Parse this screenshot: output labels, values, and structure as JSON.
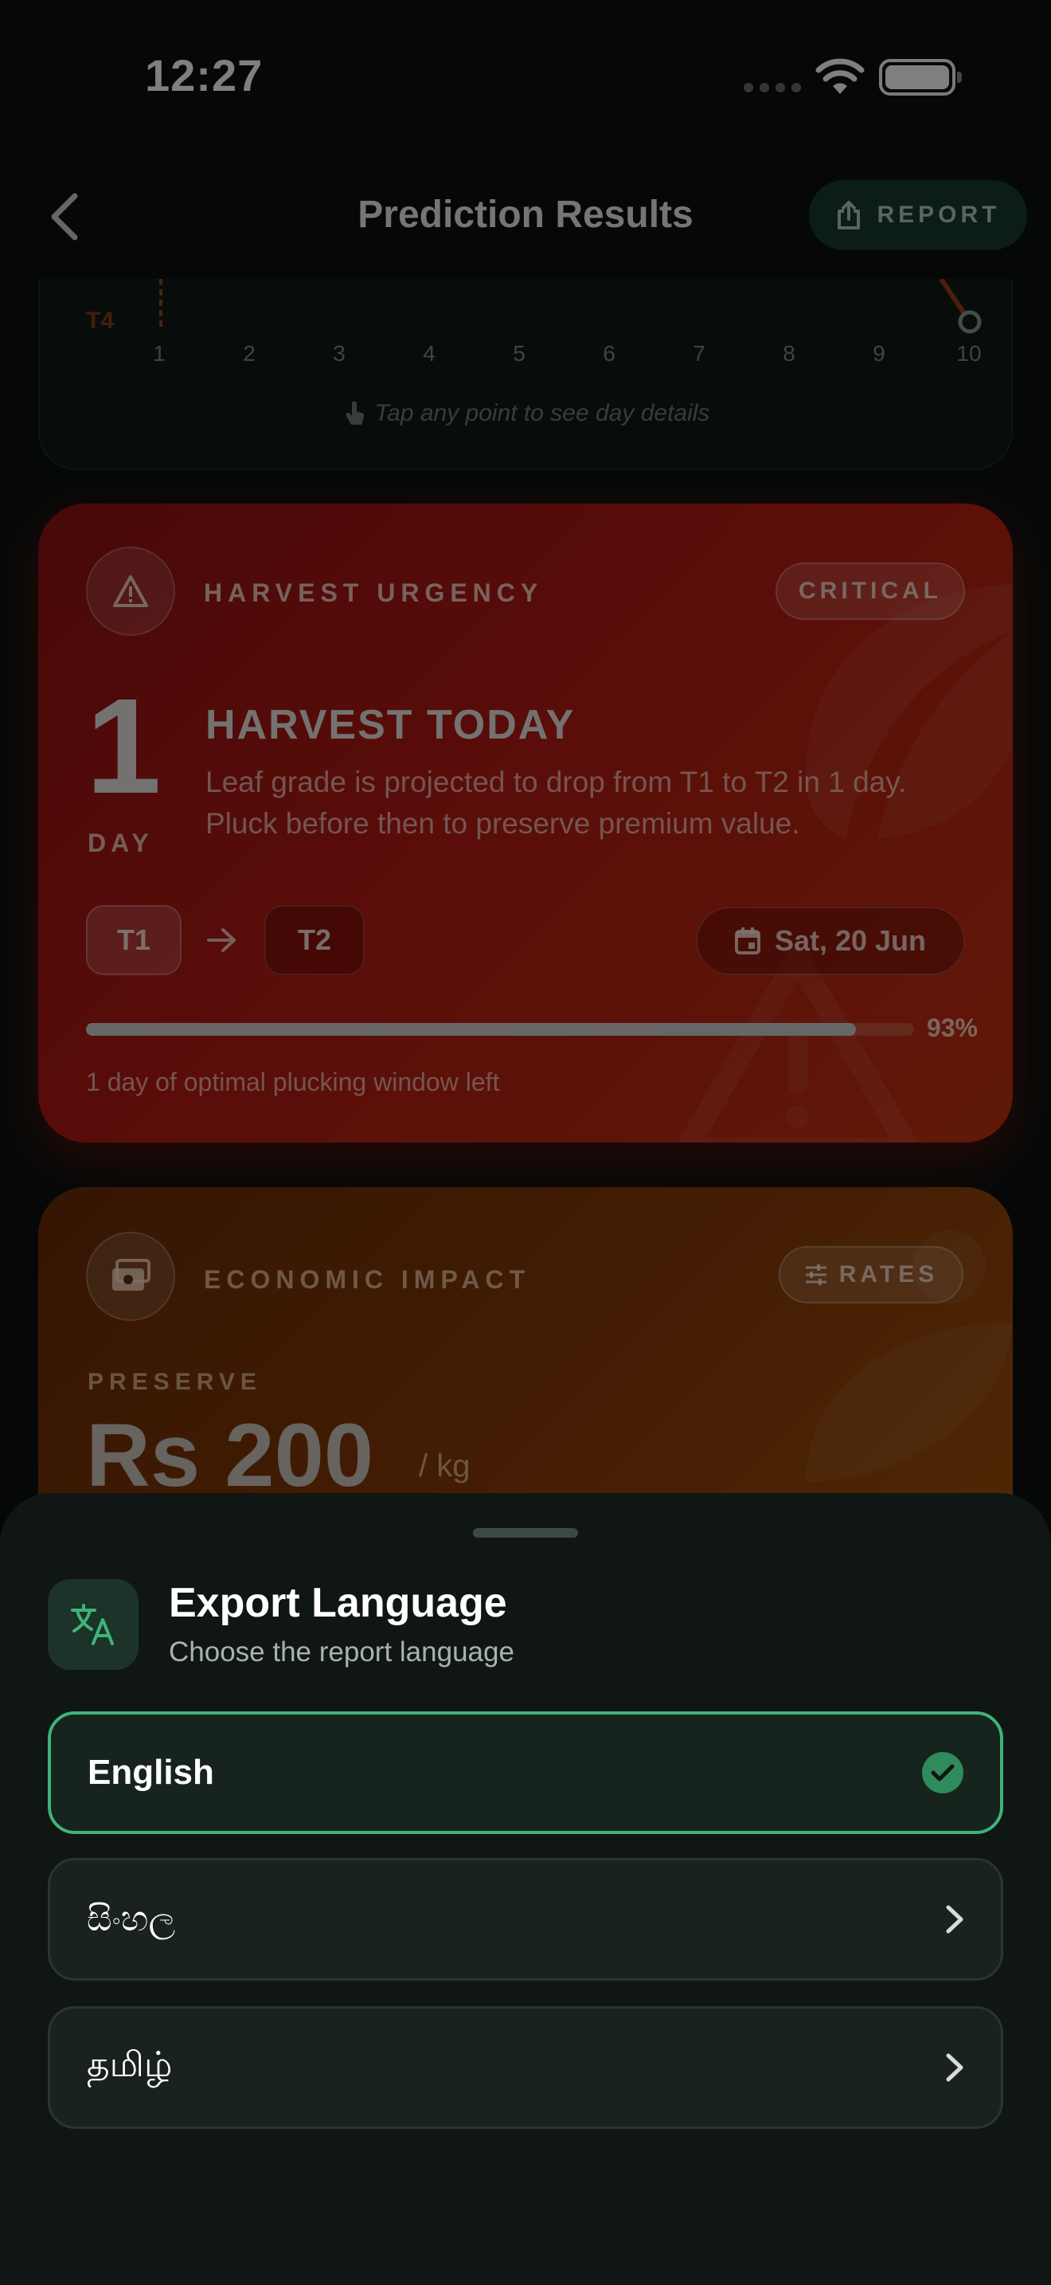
{
  "status_bar": {
    "time": "12:27"
  },
  "nav": {
    "title": "Prediction Results",
    "report_label": "REPORT"
  },
  "chart_card": {
    "series_label": "T4",
    "x_ticks": [
      "1",
      "2",
      "3",
      "4",
      "5",
      "6",
      "7",
      "8",
      "9",
      "10"
    ],
    "hint": "Tap any point to see day details"
  },
  "urgency": {
    "kicker": "HARVEST URGENCY",
    "badge": "CRITICAL",
    "days_value": "1",
    "days_unit": "DAY",
    "title": "HARVEST TODAY",
    "description": "Leaf grade is projected to drop from T1 to T2 in 1 day. Pluck before then to preserve premium value.",
    "grade_from": "T1",
    "grade_to": "T2",
    "date": "Sat, 20 Jun",
    "progress_percent": 93,
    "progress_label": "93%",
    "window_text": "1 day of optimal plucking window left",
    "color": "#b41a12"
  },
  "economic": {
    "kicker": "ECONOMIC IMPACT",
    "rates_label": "RATES",
    "preserve_label": "PRESERVE",
    "price": "Rs 200",
    "unit": "/ kg"
  },
  "sheet": {
    "title": "Export Language",
    "subtitle": "Choose the report language",
    "accent": "#3fb37a",
    "options": [
      {
        "label": "English",
        "selected": true
      },
      {
        "label": "සිංහල",
        "selected": false
      },
      {
        "label": "தமிழ்",
        "selected": false
      }
    ]
  }
}
